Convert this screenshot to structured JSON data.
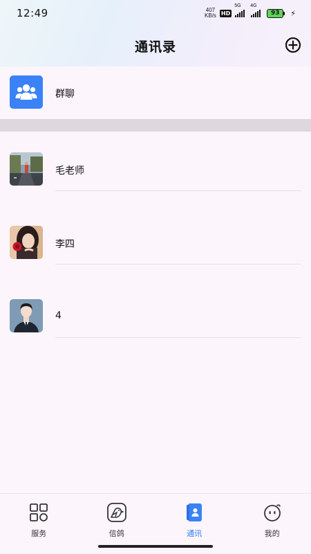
{
  "status_bar": {
    "time": "12:49",
    "net_speed_value": "407",
    "net_speed_unit": "KB/s",
    "hd": "HD",
    "sig1_label": "5G",
    "sig2_label": "4G",
    "battery": "93",
    "charging_icon": "bolt-icon"
  },
  "header": {
    "title": "通讯录",
    "add_icon": "plus-circle-icon"
  },
  "group_chat": {
    "label": "群聊",
    "icon": "group-icon",
    "accent": "#3b82f6"
  },
  "contacts": [
    {
      "name": "毛老师",
      "avatar": "street-photo-avatar"
    },
    {
      "name": "李四",
      "avatar": "girl-with-rose-avatar"
    },
    {
      "name": "4",
      "avatar": "man-in-suit-avatar"
    }
  ],
  "bottom_nav": {
    "active_color": "#2f7bf0",
    "items": [
      {
        "label": "服务",
        "icon": "grid-icon",
        "active": false
      },
      {
        "label": "信鸽",
        "icon": "pigeon-icon",
        "active": false
      },
      {
        "label": "通讯",
        "icon": "contacts-book-icon",
        "active": true
      },
      {
        "label": "我的",
        "icon": "profile-face-icon",
        "active": false
      }
    ]
  }
}
